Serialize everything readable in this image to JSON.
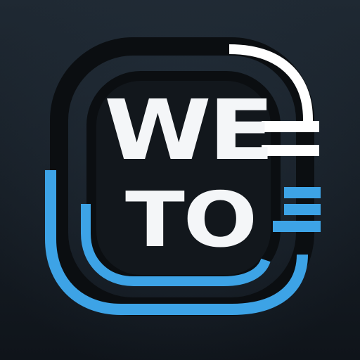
{
  "logo": {
    "line1": "WE",
    "line2": "TO"
  },
  "colors": {
    "background_top": "#1f2933",
    "background_bottom": "#0f141a",
    "ring_dark": "#0b0e11",
    "ring_white": "#ffffff",
    "ring_blue": "#3da3e6",
    "letter": "#f4f6f8"
  },
  "icons": [
    "weto-logo-icon"
  ]
}
